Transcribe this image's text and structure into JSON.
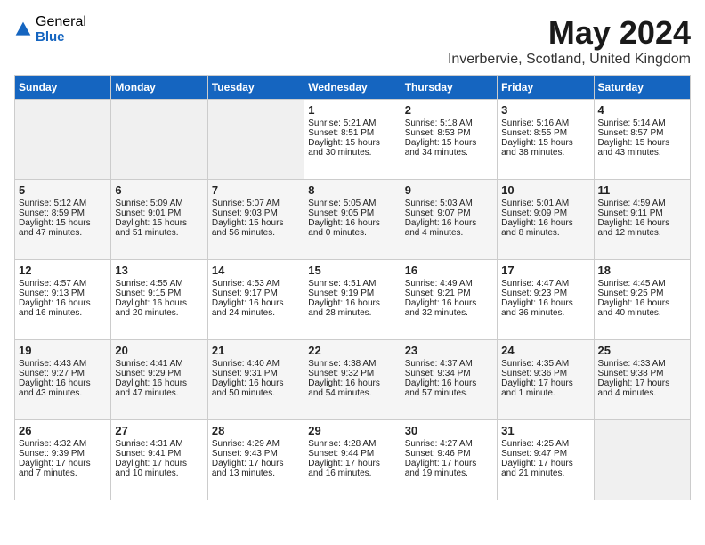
{
  "header": {
    "logo_general": "General",
    "logo_blue": "Blue",
    "month_year": "May 2024",
    "location": "Inverbervie, Scotland, United Kingdom"
  },
  "weekdays": [
    "Sunday",
    "Monday",
    "Tuesday",
    "Wednesday",
    "Thursday",
    "Friday",
    "Saturday"
  ],
  "weeks": [
    [
      {
        "day": "",
        "sunrise": "",
        "sunset": "",
        "daylight": ""
      },
      {
        "day": "",
        "sunrise": "",
        "sunset": "",
        "daylight": ""
      },
      {
        "day": "",
        "sunrise": "",
        "sunset": "",
        "daylight": ""
      },
      {
        "day": "1",
        "sunrise": "Sunrise: 5:21 AM",
        "sunset": "Sunset: 8:51 PM",
        "daylight": "Daylight: 15 hours and 30 minutes."
      },
      {
        "day": "2",
        "sunrise": "Sunrise: 5:18 AM",
        "sunset": "Sunset: 8:53 PM",
        "daylight": "Daylight: 15 hours and 34 minutes."
      },
      {
        "day": "3",
        "sunrise": "Sunrise: 5:16 AM",
        "sunset": "Sunset: 8:55 PM",
        "daylight": "Daylight: 15 hours and 38 minutes."
      },
      {
        "day": "4",
        "sunrise": "Sunrise: 5:14 AM",
        "sunset": "Sunset: 8:57 PM",
        "daylight": "Daylight: 15 hours and 43 minutes."
      }
    ],
    [
      {
        "day": "5",
        "sunrise": "Sunrise: 5:12 AM",
        "sunset": "Sunset: 8:59 PM",
        "daylight": "Daylight: 15 hours and 47 minutes."
      },
      {
        "day": "6",
        "sunrise": "Sunrise: 5:09 AM",
        "sunset": "Sunset: 9:01 PM",
        "daylight": "Daylight: 15 hours and 51 minutes."
      },
      {
        "day": "7",
        "sunrise": "Sunrise: 5:07 AM",
        "sunset": "Sunset: 9:03 PM",
        "daylight": "Daylight: 15 hours and 56 minutes."
      },
      {
        "day": "8",
        "sunrise": "Sunrise: 5:05 AM",
        "sunset": "Sunset: 9:05 PM",
        "daylight": "Daylight: 16 hours and 0 minutes."
      },
      {
        "day": "9",
        "sunrise": "Sunrise: 5:03 AM",
        "sunset": "Sunset: 9:07 PM",
        "daylight": "Daylight: 16 hours and 4 minutes."
      },
      {
        "day": "10",
        "sunrise": "Sunrise: 5:01 AM",
        "sunset": "Sunset: 9:09 PM",
        "daylight": "Daylight: 16 hours and 8 minutes."
      },
      {
        "day": "11",
        "sunrise": "Sunrise: 4:59 AM",
        "sunset": "Sunset: 9:11 PM",
        "daylight": "Daylight: 16 hours and 12 minutes."
      }
    ],
    [
      {
        "day": "12",
        "sunrise": "Sunrise: 4:57 AM",
        "sunset": "Sunset: 9:13 PM",
        "daylight": "Daylight: 16 hours and 16 minutes."
      },
      {
        "day": "13",
        "sunrise": "Sunrise: 4:55 AM",
        "sunset": "Sunset: 9:15 PM",
        "daylight": "Daylight: 16 hours and 20 minutes."
      },
      {
        "day": "14",
        "sunrise": "Sunrise: 4:53 AM",
        "sunset": "Sunset: 9:17 PM",
        "daylight": "Daylight: 16 hours and 24 minutes."
      },
      {
        "day": "15",
        "sunrise": "Sunrise: 4:51 AM",
        "sunset": "Sunset: 9:19 PM",
        "daylight": "Daylight: 16 hours and 28 minutes."
      },
      {
        "day": "16",
        "sunrise": "Sunrise: 4:49 AM",
        "sunset": "Sunset: 9:21 PM",
        "daylight": "Daylight: 16 hours and 32 minutes."
      },
      {
        "day": "17",
        "sunrise": "Sunrise: 4:47 AM",
        "sunset": "Sunset: 9:23 PM",
        "daylight": "Daylight: 16 hours and 36 minutes."
      },
      {
        "day": "18",
        "sunrise": "Sunrise: 4:45 AM",
        "sunset": "Sunset: 9:25 PM",
        "daylight": "Daylight: 16 hours and 40 minutes."
      }
    ],
    [
      {
        "day": "19",
        "sunrise": "Sunrise: 4:43 AM",
        "sunset": "Sunset: 9:27 PM",
        "daylight": "Daylight: 16 hours and 43 minutes."
      },
      {
        "day": "20",
        "sunrise": "Sunrise: 4:41 AM",
        "sunset": "Sunset: 9:29 PM",
        "daylight": "Daylight: 16 hours and 47 minutes."
      },
      {
        "day": "21",
        "sunrise": "Sunrise: 4:40 AM",
        "sunset": "Sunset: 9:31 PM",
        "daylight": "Daylight: 16 hours and 50 minutes."
      },
      {
        "day": "22",
        "sunrise": "Sunrise: 4:38 AM",
        "sunset": "Sunset: 9:32 PM",
        "daylight": "Daylight: 16 hours and 54 minutes."
      },
      {
        "day": "23",
        "sunrise": "Sunrise: 4:37 AM",
        "sunset": "Sunset: 9:34 PM",
        "daylight": "Daylight: 16 hours and 57 minutes."
      },
      {
        "day": "24",
        "sunrise": "Sunrise: 4:35 AM",
        "sunset": "Sunset: 9:36 PM",
        "daylight": "Daylight: 17 hours and 1 minute."
      },
      {
        "day": "25",
        "sunrise": "Sunrise: 4:33 AM",
        "sunset": "Sunset: 9:38 PM",
        "daylight": "Daylight: 17 hours and 4 minutes."
      }
    ],
    [
      {
        "day": "26",
        "sunrise": "Sunrise: 4:32 AM",
        "sunset": "Sunset: 9:39 PM",
        "daylight": "Daylight: 17 hours and 7 minutes."
      },
      {
        "day": "27",
        "sunrise": "Sunrise: 4:31 AM",
        "sunset": "Sunset: 9:41 PM",
        "daylight": "Daylight: 17 hours and 10 minutes."
      },
      {
        "day": "28",
        "sunrise": "Sunrise: 4:29 AM",
        "sunset": "Sunset: 9:43 PM",
        "daylight": "Daylight: 17 hours and 13 minutes."
      },
      {
        "day": "29",
        "sunrise": "Sunrise: 4:28 AM",
        "sunset": "Sunset: 9:44 PM",
        "daylight": "Daylight: 17 hours and 16 minutes."
      },
      {
        "day": "30",
        "sunrise": "Sunrise: 4:27 AM",
        "sunset": "Sunset: 9:46 PM",
        "daylight": "Daylight: 17 hours and 19 minutes."
      },
      {
        "day": "31",
        "sunrise": "Sunrise: 4:25 AM",
        "sunset": "Sunset: 9:47 PM",
        "daylight": "Daylight: 17 hours and 21 minutes."
      },
      {
        "day": "",
        "sunrise": "",
        "sunset": "",
        "daylight": ""
      }
    ]
  ]
}
